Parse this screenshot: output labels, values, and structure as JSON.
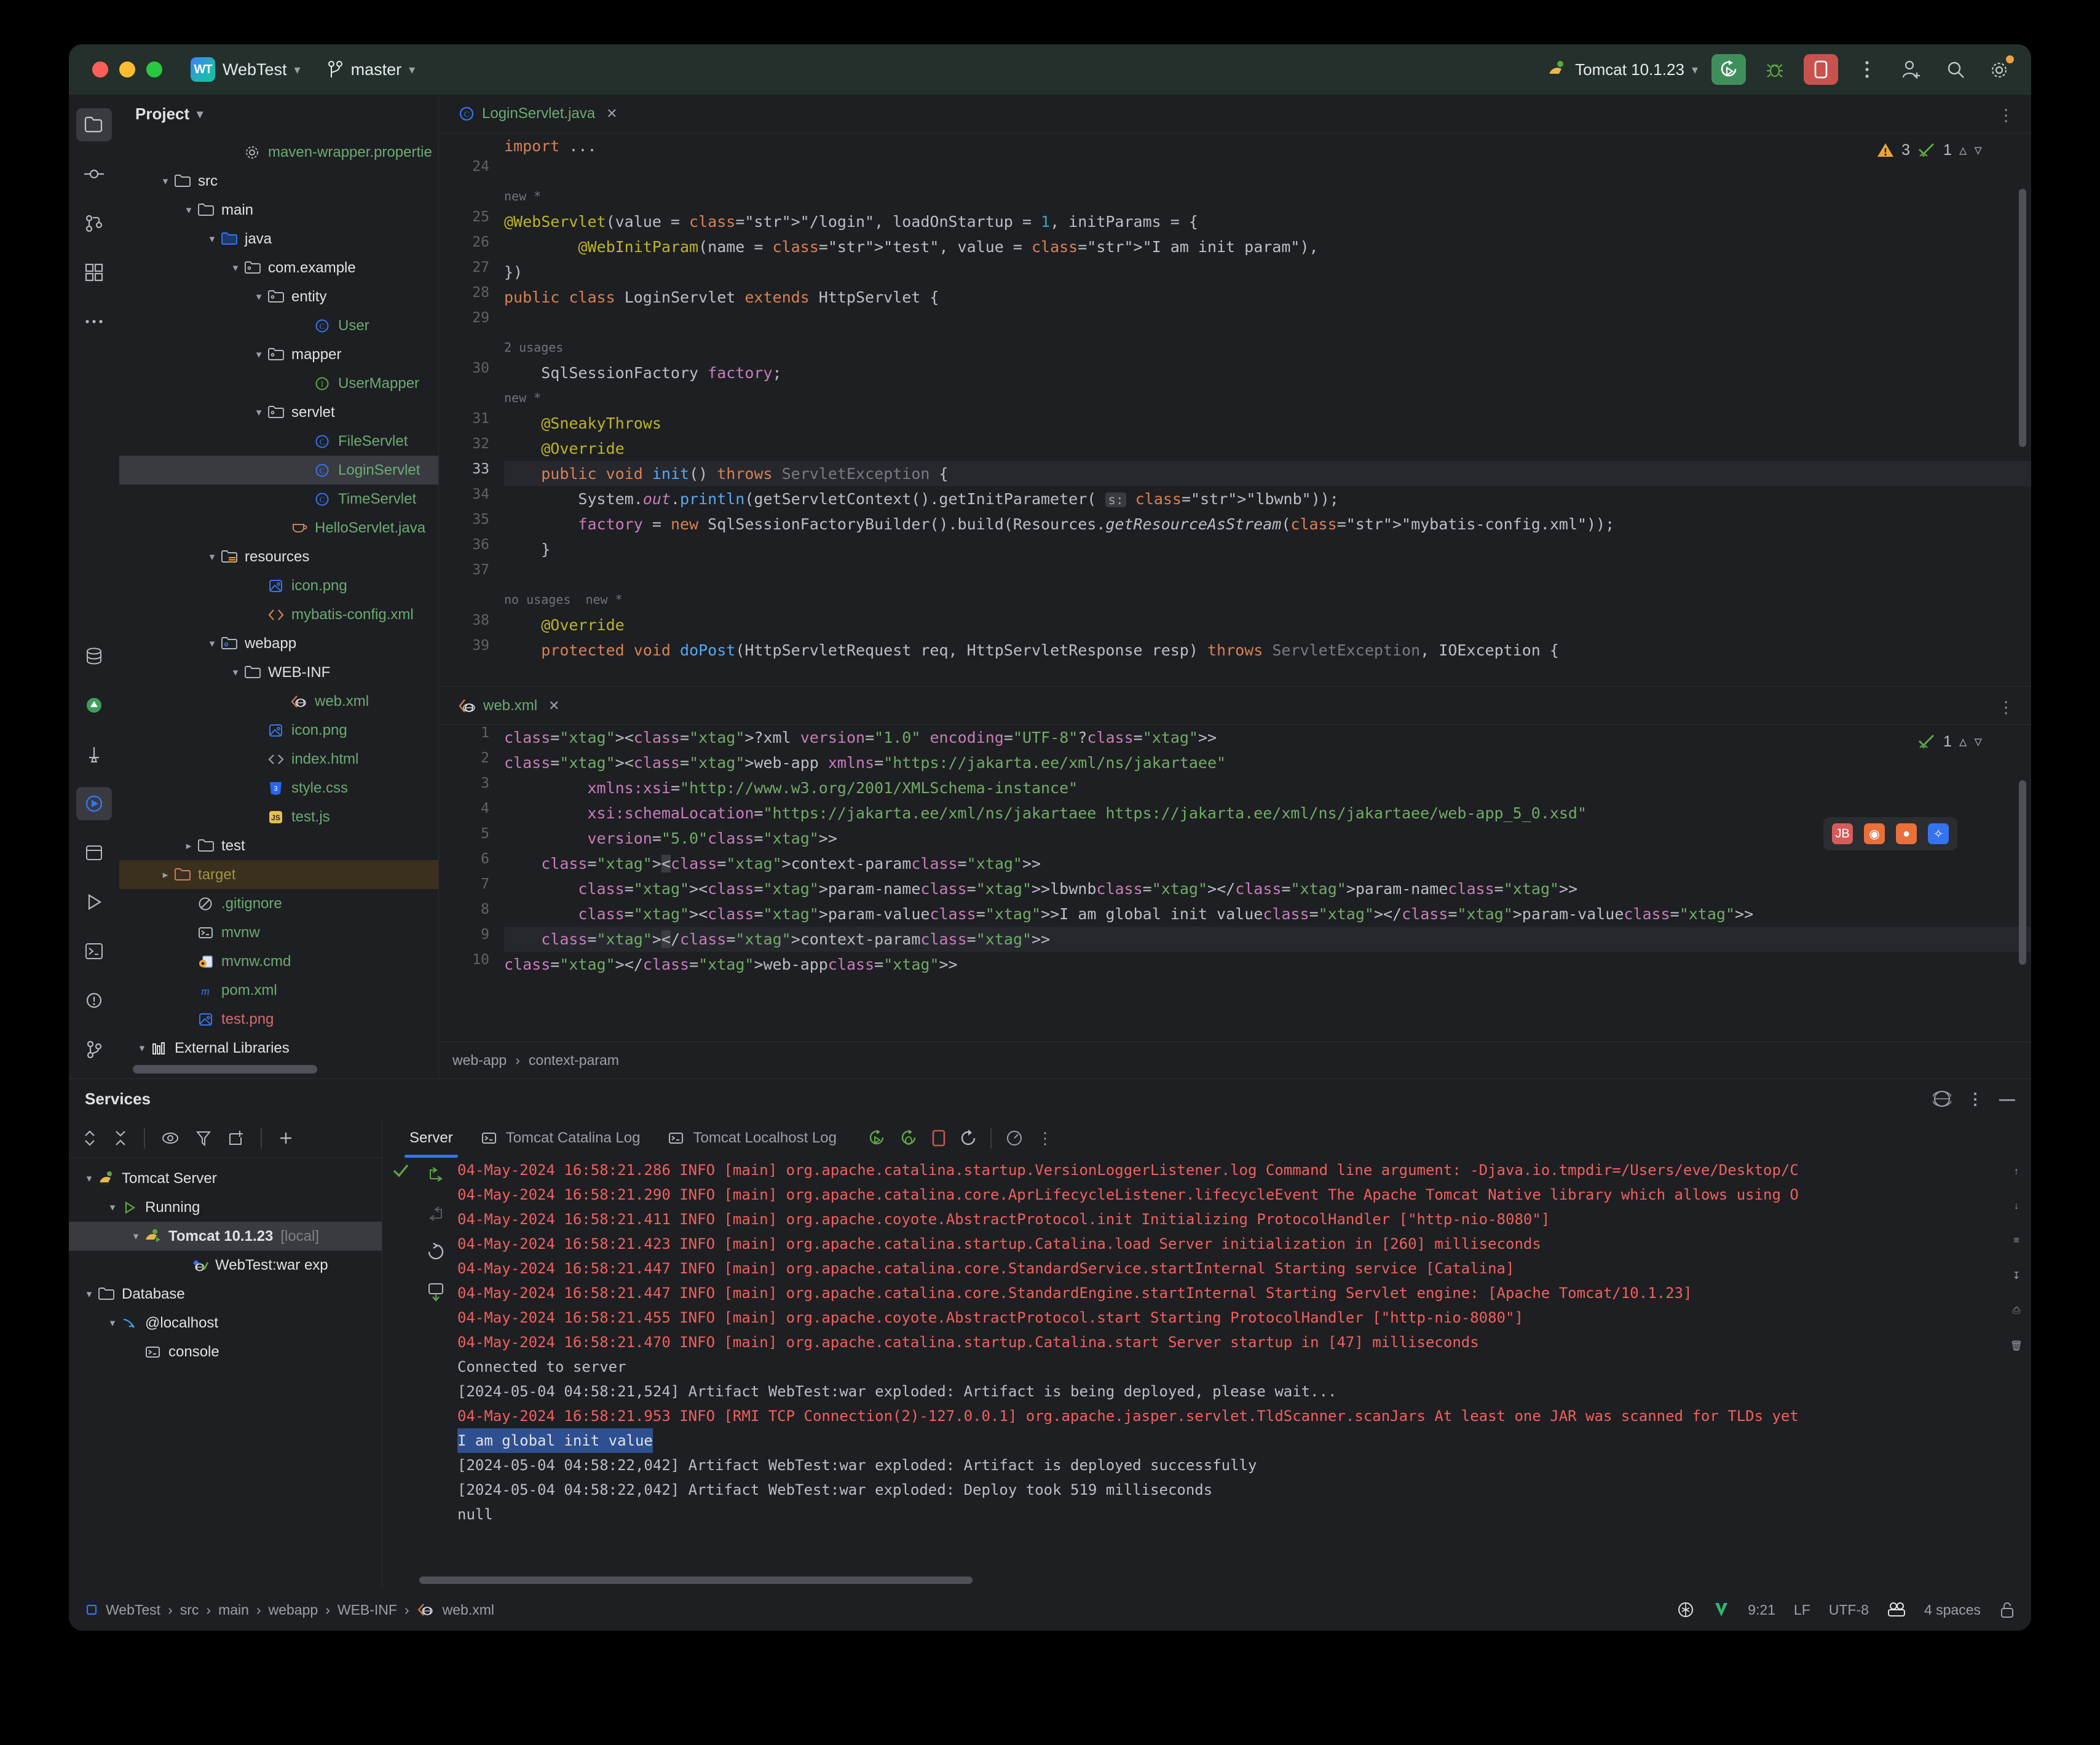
{
  "titlebar": {
    "project_badge": "WT",
    "project_name": "WebTest",
    "branch": "master",
    "run_config": "Tomcat 10.1.23",
    "chevron": "⌄"
  },
  "project_panel": {
    "title": "Project",
    "tree": [
      {
        "label": "maven-wrapper.propertie",
        "indent": 4,
        "icon": "gear-icon",
        "color": "green",
        "arrow": ""
      },
      {
        "label": "src",
        "indent": 1,
        "icon": "folder-icon",
        "color": "white",
        "arrow": "v"
      },
      {
        "label": "main",
        "indent": 2,
        "icon": "folder-icon",
        "color": "white",
        "arrow": "v"
      },
      {
        "label": "java",
        "indent": 3,
        "icon": "folder-source-icon",
        "color": "white",
        "arrow": "v"
      },
      {
        "label": "com.example",
        "indent": 4,
        "icon": "package-icon",
        "color": "white",
        "arrow": "v"
      },
      {
        "label": "entity",
        "indent": 5,
        "icon": "package-icon",
        "color": "white",
        "arrow": "v"
      },
      {
        "label": "User",
        "indent": 7,
        "icon": "class-icon",
        "color": "green",
        "arrow": ""
      },
      {
        "label": "mapper",
        "indent": 5,
        "icon": "package-icon",
        "color": "white",
        "arrow": "v"
      },
      {
        "label": "UserMapper",
        "indent": 7,
        "icon": "interface-icon",
        "color": "green",
        "arrow": ""
      },
      {
        "label": "servlet",
        "indent": 5,
        "icon": "package-icon",
        "color": "white",
        "arrow": "v"
      },
      {
        "label": "FileServlet",
        "indent": 7,
        "icon": "class-icon",
        "color": "green",
        "arrow": ""
      },
      {
        "label": "LoginServlet",
        "indent": 7,
        "icon": "class-icon",
        "color": "green",
        "arrow": "",
        "selected": true
      },
      {
        "label": "TimeServlet",
        "indent": 7,
        "icon": "class-icon",
        "color": "green",
        "arrow": ""
      },
      {
        "label": "HelloServlet.java",
        "indent": 6,
        "icon": "java-file-icon",
        "color": "green",
        "arrow": ""
      },
      {
        "label": "resources",
        "indent": 3,
        "icon": "folder-resources-icon",
        "color": "white",
        "arrow": "v"
      },
      {
        "label": "icon.png",
        "indent": 5,
        "icon": "image-icon",
        "color": "green",
        "arrow": ""
      },
      {
        "label": "mybatis-config.xml",
        "indent": 5,
        "icon": "xml-icon",
        "color": "green",
        "arrow": ""
      },
      {
        "label": "webapp",
        "indent": 3,
        "icon": "folder-webapp-icon",
        "color": "white",
        "arrow": "v"
      },
      {
        "label": "WEB-INF",
        "indent": 4,
        "icon": "folder-icon",
        "color": "white",
        "arrow": "v"
      },
      {
        "label": "web.xml",
        "indent": 6,
        "icon": "webxml-icon",
        "color": "green",
        "arrow": ""
      },
      {
        "label": "icon.png",
        "indent": 5,
        "icon": "image-icon",
        "color": "green",
        "arrow": ""
      },
      {
        "label": "index.html",
        "indent": 5,
        "icon": "html-icon",
        "color": "green",
        "arrow": ""
      },
      {
        "label": "style.css",
        "indent": 5,
        "icon": "css-icon",
        "color": "green",
        "arrow": ""
      },
      {
        "label": "test.js",
        "indent": 5,
        "icon": "js-icon",
        "color": "green",
        "arrow": ""
      },
      {
        "label": "test",
        "indent": 2,
        "icon": "folder-icon",
        "color": "white",
        "arrow": ">"
      },
      {
        "label": "target",
        "indent": 1,
        "icon": "folder-excluded-icon",
        "color": "yellow",
        "arrow": ">",
        "amber": true
      },
      {
        "label": ".gitignore",
        "indent": 2,
        "icon": "gitignore-icon",
        "color": "green",
        "arrow": ""
      },
      {
        "label": "mvnw",
        "indent": 2,
        "icon": "shell-icon",
        "color": "green",
        "arrow": ""
      },
      {
        "label": "mvnw.cmd",
        "indent": 2,
        "icon": "cmd-icon",
        "color": "green",
        "arrow": ""
      },
      {
        "label": "pom.xml",
        "indent": 2,
        "icon": "maven-icon",
        "color": "green",
        "arrow": ""
      },
      {
        "label": "test.png",
        "indent": 2,
        "icon": "image-icon",
        "color": "rose",
        "arrow": ""
      },
      {
        "label": "External Libraries",
        "indent": 0,
        "icon": "libraries-icon",
        "color": "white",
        "arrow": "v"
      }
    ]
  },
  "java_editor": {
    "tab_label": "LoginServlet.java",
    "warnings_count": "3",
    "ok_count": "1",
    "lines": [
      {
        "no": "",
        "kind": "import",
        "text": "import ..."
      },
      {
        "no": "24",
        "kind": "blank",
        "text": ""
      },
      {
        "no": "",
        "kind": "hint",
        "text": "new *"
      },
      {
        "no": "25",
        "kind": "code",
        "text": "@WebServlet(value = \"/login\", loadOnStartup = 1, initParams = {"
      },
      {
        "no": "26",
        "kind": "code",
        "text": "        @WebInitParam(name = \"test\", value = \"I am init param\"),"
      },
      {
        "no": "27",
        "kind": "code",
        "text": "})"
      },
      {
        "no": "28",
        "kind": "code",
        "text": "public class LoginServlet extends HttpServlet {"
      },
      {
        "no": "29",
        "kind": "blank",
        "text": ""
      },
      {
        "no": "",
        "kind": "hint",
        "text": "2 usages"
      },
      {
        "no": "30",
        "kind": "code",
        "text": "    SqlSessionFactory factory;"
      },
      {
        "no": "",
        "kind": "hint",
        "text": "new *"
      },
      {
        "no": "31",
        "kind": "code",
        "text": "    @SneakyThrows"
      },
      {
        "no": "32",
        "kind": "code",
        "text": "    @Override"
      },
      {
        "no": "33",
        "kind": "code",
        "text": "    public void init() throws ServletException {",
        "current": true
      },
      {
        "no": "34",
        "kind": "code",
        "text": "        System.out.println(getServletContext().getInitParameter( s: \"lbwnb\"));"
      },
      {
        "no": "35",
        "kind": "code",
        "text": "        factory = new SqlSessionFactoryBuilder().build(Resources.getResourceAsStream(\"mybatis-config.xml\"));"
      },
      {
        "no": "36",
        "kind": "code",
        "text": "    }"
      },
      {
        "no": "37",
        "kind": "blank",
        "text": ""
      },
      {
        "no": "",
        "kind": "hint",
        "text": "no usages  new *"
      },
      {
        "no": "38",
        "kind": "code",
        "text": "    @Override"
      },
      {
        "no": "39",
        "kind": "code",
        "text": "    protected void doPost(HttpServletRequest req, HttpServletResponse resp) throws ServletException, IOException {"
      }
    ]
  },
  "xml_editor": {
    "tab_label": "web.xml",
    "ok_count": "1",
    "lines": [
      {
        "no": "1",
        "text": "<?xml version=\"1.0\" encoding=\"UTF-8\"?>"
      },
      {
        "no": "2",
        "text": "<web-app xmlns=\"https://jakarta.ee/xml/ns/jakartaee\""
      },
      {
        "no": "3",
        "text": "         xmlns:xsi=\"http://www.w3.org/2001/XMLSchema-instance\""
      },
      {
        "no": "4",
        "text": "         xsi:schemaLocation=\"https://jakarta.ee/xml/ns/jakartaee https://jakarta.ee/xml/ns/jakartaee/web-app_5_0.xsd\""
      },
      {
        "no": "5",
        "text": "         version=\"5.0\">"
      },
      {
        "no": "6",
        "text": "    <context-param>"
      },
      {
        "no": "7",
        "text": "        <param-name>lbwnb</param-name>"
      },
      {
        "no": "8",
        "text": "        <param-value>I am global init value</param-value>"
      },
      {
        "no": "9",
        "text": "    </context-param>"
      },
      {
        "no": "10",
        "text": "</web-app>"
      }
    ],
    "breadcrumb": [
      "web-app",
      "context-param"
    ]
  },
  "services": {
    "title": "Services",
    "tree": [
      {
        "label": "Tomcat Server",
        "indent": 0,
        "icon": "tomcat-icon",
        "arrow": "v",
        "bold": false
      },
      {
        "label": "Running",
        "indent": 1,
        "icon": "run-icon",
        "arrow": "v"
      },
      {
        "label": "Tomcat 10.1.23",
        "suffix": "[local]",
        "indent": 2,
        "icon": "tomcat-run-icon",
        "arrow": "v",
        "selected": true,
        "bold": true
      },
      {
        "label": "WebTest:war exp",
        "indent": 4,
        "icon": "artifact-icon",
        "arrow": ""
      },
      {
        "label": "Database",
        "indent": 0,
        "icon": "folder-icon",
        "arrow": "v"
      },
      {
        "label": "@localhost",
        "indent": 1,
        "icon": "mysql-icon",
        "arrow": "v"
      },
      {
        "label": "console",
        "indent": 2,
        "icon": "console-icon",
        "arrow": ""
      }
    ],
    "log_tabs": [
      {
        "label": "Server",
        "icon": "",
        "active": true
      },
      {
        "label": "Tomcat Catalina Log",
        "icon": "console-icon",
        "active": false
      },
      {
        "label": "Tomcat Localhost Log",
        "icon": "console-icon",
        "active": false
      }
    ],
    "log_lines": [
      {
        "text": "04-May-2024 16:58:21.286 INFO [main] org.apache.catalina.startup.VersionLoggerListener.log Command line argument: -Djava.io.tmpdir=/Users/eve/Desktop/C",
        "color": "red"
      },
      {
        "text": "04-May-2024 16:58:21.290 INFO [main] org.apache.catalina.core.AprLifecycleListener.lifecycleEvent The Apache Tomcat Native library which allows using O",
        "color": "red"
      },
      {
        "text": "04-May-2024 16:58:21.411 INFO [main] org.apache.coyote.AbstractProtocol.init Initializing ProtocolHandler [\"http-nio-8080\"]",
        "color": "red"
      },
      {
        "text": "04-May-2024 16:58:21.423 INFO [main] org.apache.catalina.startup.Catalina.load Server initialization in [260] milliseconds",
        "color": "red"
      },
      {
        "text": "04-May-2024 16:58:21.447 INFO [main] org.apache.catalina.core.StandardService.startInternal Starting service [Catalina]",
        "color": "red"
      },
      {
        "text": "04-May-2024 16:58:21.447 INFO [main] org.apache.catalina.core.StandardEngine.startInternal Starting Servlet engine: [Apache Tomcat/10.1.23]",
        "color": "red"
      },
      {
        "text": "04-May-2024 16:58:21.455 INFO [main] org.apache.coyote.AbstractProtocol.start Starting ProtocolHandler [\"http-nio-8080\"]",
        "color": "red"
      },
      {
        "text": "04-May-2024 16:58:21.470 INFO [main] org.apache.catalina.startup.Catalina.start Server startup in [47] milliseconds",
        "color": "red"
      },
      {
        "text": "Connected to server",
        "color": "gray"
      },
      {
        "text": "[2024-05-04 04:58:21,524] Artifact WebTest:war exploded: Artifact is being deployed, please wait...",
        "color": "gray"
      },
      {
        "text": "04-May-2024 16:58:21.953 INFO [RMI TCP Connection(2)-127.0.0.1] org.apache.jasper.servlet.TldScanner.scanJars At least one JAR was scanned for TLDs yet",
        "color": "red"
      },
      {
        "text": "I am global init value",
        "color": "selected"
      },
      {
        "text": "[2024-05-04 04:58:22,042] Artifact WebTest:war exploded: Artifact is deployed successfully",
        "color": "gray"
      },
      {
        "text": "[2024-05-04 04:58:22,042] Artifact WebTest:war exploded: Deploy took 519 milliseconds",
        "color": "gray"
      },
      {
        "text": "null",
        "color": "gray"
      }
    ]
  },
  "statusbar": {
    "crumbs": [
      "WebTest",
      "src",
      "main",
      "webapp",
      "WEB-INF",
      "web.xml"
    ],
    "caret": "9:21",
    "line_sep": "LF",
    "encoding": "UTF-8",
    "indent": "4 spaces"
  }
}
